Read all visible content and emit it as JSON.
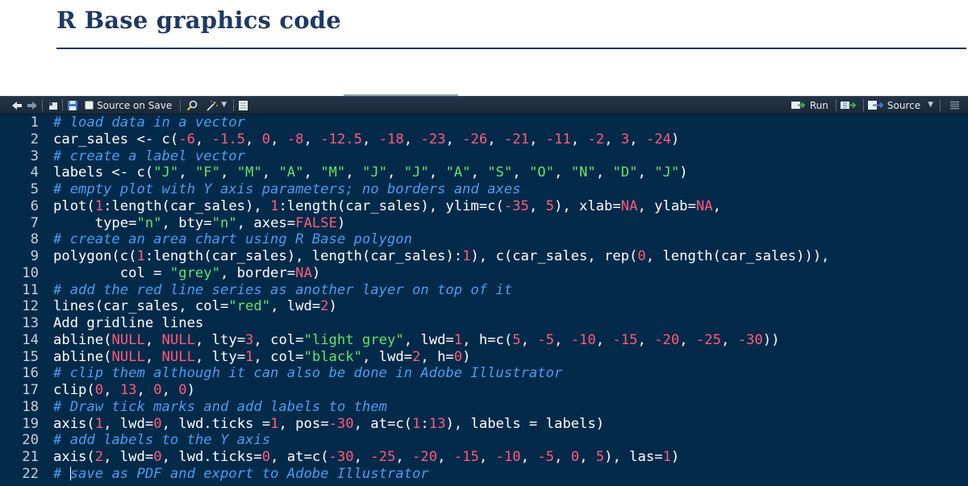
{
  "title": "R Base graphics code",
  "toolbar": {
    "source_on_save_label": "Source on Save",
    "run_label": "Run",
    "source_label": "Source"
  },
  "code_lines": [
    {
      "n": "1",
      "tokens": [
        {
          "t": "# load data in a vector",
          "c": "comment"
        }
      ]
    },
    {
      "n": "2",
      "tokens": [
        {
          "t": "car_sales <- c(",
          "c": "plain"
        },
        {
          "t": "-6",
          "c": "num"
        },
        {
          "t": ", ",
          "c": "plain"
        },
        {
          "t": "-1.5",
          "c": "num"
        },
        {
          "t": ", ",
          "c": "plain"
        },
        {
          "t": "0",
          "c": "num"
        },
        {
          "t": ", ",
          "c": "plain"
        },
        {
          "t": "-8",
          "c": "num"
        },
        {
          "t": ", ",
          "c": "plain"
        },
        {
          "t": "-12.5",
          "c": "num"
        },
        {
          "t": ", ",
          "c": "plain"
        },
        {
          "t": "-18",
          "c": "num"
        },
        {
          "t": ", ",
          "c": "plain"
        },
        {
          "t": "-23",
          "c": "num"
        },
        {
          "t": ", ",
          "c": "plain"
        },
        {
          "t": "-26",
          "c": "num"
        },
        {
          "t": ", ",
          "c": "plain"
        },
        {
          "t": "-21",
          "c": "num"
        },
        {
          "t": ", ",
          "c": "plain"
        },
        {
          "t": "-11",
          "c": "num"
        },
        {
          "t": ", ",
          "c": "plain"
        },
        {
          "t": "-2",
          "c": "num"
        },
        {
          "t": ", ",
          "c": "plain"
        },
        {
          "t": "3",
          "c": "num"
        },
        {
          "t": ", ",
          "c": "plain"
        },
        {
          "t": "-24",
          "c": "num"
        },
        {
          "t": ")",
          "c": "plain"
        }
      ]
    },
    {
      "n": "3",
      "tokens": [
        {
          "t": "# create a label vector",
          "c": "comment"
        }
      ]
    },
    {
      "n": "4",
      "tokens": [
        {
          "t": "labels <- c(",
          "c": "plain"
        },
        {
          "t": "\"J\"",
          "c": "str"
        },
        {
          "t": ", ",
          "c": "plain"
        },
        {
          "t": "\"F\"",
          "c": "str"
        },
        {
          "t": ", ",
          "c": "plain"
        },
        {
          "t": "\"M\"",
          "c": "str"
        },
        {
          "t": ", ",
          "c": "plain"
        },
        {
          "t": "\"A\"",
          "c": "str"
        },
        {
          "t": ", ",
          "c": "plain"
        },
        {
          "t": "\"M\"",
          "c": "str"
        },
        {
          "t": ", ",
          "c": "plain"
        },
        {
          "t": "\"J\"",
          "c": "str"
        },
        {
          "t": ", ",
          "c": "plain"
        },
        {
          "t": "\"J\"",
          "c": "str"
        },
        {
          "t": ", ",
          "c": "plain"
        },
        {
          "t": "\"A\"",
          "c": "str"
        },
        {
          "t": ", ",
          "c": "plain"
        },
        {
          "t": "\"S\"",
          "c": "str"
        },
        {
          "t": ", ",
          "c": "plain"
        },
        {
          "t": "\"O\"",
          "c": "str"
        },
        {
          "t": ", ",
          "c": "plain"
        },
        {
          "t": "\"N\"",
          "c": "str"
        },
        {
          "t": ", ",
          "c": "plain"
        },
        {
          "t": "\"D\"",
          "c": "str"
        },
        {
          "t": ", ",
          "c": "plain"
        },
        {
          "t": "\"J\"",
          "c": "str"
        },
        {
          "t": ")",
          "c": "plain"
        }
      ]
    },
    {
      "n": "5",
      "tokens": [
        {
          "t": "# empty plot with Y axis parameters; no borders and axes",
          "c": "comment"
        }
      ]
    },
    {
      "n": "6",
      "tokens": [
        {
          "t": "plot(",
          "c": "plain"
        },
        {
          "t": "1",
          "c": "num"
        },
        {
          "t": ":length(car_sales), ",
          "c": "plain"
        },
        {
          "t": "1",
          "c": "num"
        },
        {
          "t": ":length(car_sales), ylim=c(",
          "c": "plain"
        },
        {
          "t": "-35",
          "c": "num"
        },
        {
          "t": ", ",
          "c": "plain"
        },
        {
          "t": "5",
          "c": "num"
        },
        {
          "t": "), xlab=",
          "c": "plain"
        },
        {
          "t": "NA",
          "c": "num"
        },
        {
          "t": ", ylab=",
          "c": "plain"
        },
        {
          "t": "NA",
          "c": "num"
        },
        {
          "t": ",",
          "c": "plain"
        }
      ]
    },
    {
      "n": "7",
      "tokens": [
        {
          "t": "     type=",
          "c": "plain"
        },
        {
          "t": "\"n\"",
          "c": "str"
        },
        {
          "t": ", bty=",
          "c": "plain"
        },
        {
          "t": "\"n\"",
          "c": "str"
        },
        {
          "t": ", axes=",
          "c": "plain"
        },
        {
          "t": "FALSE",
          "c": "num"
        },
        {
          "t": ")",
          "c": "plain"
        }
      ]
    },
    {
      "n": "8",
      "tokens": [
        {
          "t": "# create an area chart using R Base polygon",
          "c": "comment"
        }
      ]
    },
    {
      "n": "9",
      "tokens": [
        {
          "t": "polygon(c(",
          "c": "plain"
        },
        {
          "t": "1",
          "c": "num"
        },
        {
          "t": ":length(car_sales), length(car_sales):",
          "c": "plain"
        },
        {
          "t": "1",
          "c": "num"
        },
        {
          "t": "), c(car_sales, rep(",
          "c": "plain"
        },
        {
          "t": "0",
          "c": "num"
        },
        {
          "t": ", length(car_sales))),",
          "c": "plain"
        }
      ]
    },
    {
      "n": "10",
      "tokens": [
        {
          "t": "        col = ",
          "c": "plain"
        },
        {
          "t": "\"grey\"",
          "c": "str"
        },
        {
          "t": ", border=",
          "c": "plain"
        },
        {
          "t": "NA",
          "c": "num"
        },
        {
          "t": ")",
          "c": "plain"
        }
      ]
    },
    {
      "n": "11",
      "tokens": [
        {
          "t": "# add the red line series as another layer on top of it",
          "c": "comment"
        }
      ]
    },
    {
      "n": "12",
      "tokens": [
        {
          "t": "lines(car_sales, col=",
          "c": "plain"
        },
        {
          "t": "\"red\"",
          "c": "str"
        },
        {
          "t": ", lwd=",
          "c": "plain"
        },
        {
          "t": "2",
          "c": "num"
        },
        {
          "t": ")",
          "c": "plain"
        }
      ]
    },
    {
      "n": "13",
      "tokens": [
        {
          "t": "Add gridline lines",
          "c": "plain"
        }
      ]
    },
    {
      "n": "14",
      "tokens": [
        {
          "t": "abline(",
          "c": "plain"
        },
        {
          "t": "NULL",
          "c": "num"
        },
        {
          "t": ", ",
          "c": "plain"
        },
        {
          "t": "NULL",
          "c": "num"
        },
        {
          "t": ", lty=",
          "c": "plain"
        },
        {
          "t": "3",
          "c": "num"
        },
        {
          "t": ", col=",
          "c": "plain"
        },
        {
          "t": "\"light grey\"",
          "c": "str"
        },
        {
          "t": ", lwd=",
          "c": "plain"
        },
        {
          "t": "1",
          "c": "num"
        },
        {
          "t": ", h=c(",
          "c": "plain"
        },
        {
          "t": "5",
          "c": "num"
        },
        {
          "t": ", ",
          "c": "plain"
        },
        {
          "t": "-5",
          "c": "num"
        },
        {
          "t": ", ",
          "c": "plain"
        },
        {
          "t": "-10",
          "c": "num"
        },
        {
          "t": ", ",
          "c": "plain"
        },
        {
          "t": "-15",
          "c": "num"
        },
        {
          "t": ", ",
          "c": "plain"
        },
        {
          "t": "-20",
          "c": "num"
        },
        {
          "t": ", ",
          "c": "plain"
        },
        {
          "t": "-25",
          "c": "num"
        },
        {
          "t": ", ",
          "c": "plain"
        },
        {
          "t": "-30",
          "c": "num"
        },
        {
          "t": "))",
          "c": "plain"
        }
      ]
    },
    {
      "n": "15",
      "tokens": [
        {
          "t": "abline(",
          "c": "plain"
        },
        {
          "t": "NULL",
          "c": "num"
        },
        {
          "t": ", ",
          "c": "plain"
        },
        {
          "t": "NULL",
          "c": "num"
        },
        {
          "t": ", lty=",
          "c": "plain"
        },
        {
          "t": "1",
          "c": "num"
        },
        {
          "t": ", col=",
          "c": "plain"
        },
        {
          "t": "\"black\"",
          "c": "str"
        },
        {
          "t": ", lwd=",
          "c": "plain"
        },
        {
          "t": "2",
          "c": "num"
        },
        {
          "t": ", h=",
          "c": "plain"
        },
        {
          "t": "0",
          "c": "num"
        },
        {
          "t": ")",
          "c": "plain"
        }
      ]
    },
    {
      "n": "16",
      "tokens": [
        {
          "t": "# clip them although it can also be done in Adobe Illustrator",
          "c": "comment"
        }
      ]
    },
    {
      "n": "17",
      "tokens": [
        {
          "t": "clip(",
          "c": "plain"
        },
        {
          "t": "0",
          "c": "num"
        },
        {
          "t": ", ",
          "c": "plain"
        },
        {
          "t": "13",
          "c": "num"
        },
        {
          "t": ", ",
          "c": "plain"
        },
        {
          "t": "0",
          "c": "num"
        },
        {
          "t": ", ",
          "c": "plain"
        },
        {
          "t": "0",
          "c": "num"
        },
        {
          "t": ")",
          "c": "plain"
        }
      ]
    },
    {
      "n": "18",
      "tokens": [
        {
          "t": "# Draw tick marks and add labels to them",
          "c": "comment"
        }
      ]
    },
    {
      "n": "19",
      "tokens": [
        {
          "t": "axis(",
          "c": "plain"
        },
        {
          "t": "1",
          "c": "num"
        },
        {
          "t": ", lwd=",
          "c": "plain"
        },
        {
          "t": "0",
          "c": "num"
        },
        {
          "t": ", lwd.ticks =",
          "c": "plain"
        },
        {
          "t": "1",
          "c": "num"
        },
        {
          "t": ", pos=",
          "c": "plain"
        },
        {
          "t": "-30",
          "c": "num"
        },
        {
          "t": ", at=c(",
          "c": "plain"
        },
        {
          "t": "1",
          "c": "num"
        },
        {
          "t": ":",
          "c": "plain"
        },
        {
          "t": "13",
          "c": "num"
        },
        {
          "t": "), labels = labels)",
          "c": "plain"
        }
      ]
    },
    {
      "n": "20",
      "tokens": [
        {
          "t": "# add labels to the Y axis",
          "c": "comment"
        }
      ]
    },
    {
      "n": "21",
      "tokens": [
        {
          "t": "axis(",
          "c": "plain"
        },
        {
          "t": "2",
          "c": "num"
        },
        {
          "t": ", lwd=",
          "c": "plain"
        },
        {
          "t": "0",
          "c": "num"
        },
        {
          "t": ", lwd.ticks=",
          "c": "plain"
        },
        {
          "t": "0",
          "c": "num"
        },
        {
          "t": ", at=c(",
          "c": "plain"
        },
        {
          "t": "-30",
          "c": "num"
        },
        {
          "t": ", ",
          "c": "plain"
        },
        {
          "t": "-25",
          "c": "num"
        },
        {
          "t": ", ",
          "c": "plain"
        },
        {
          "t": "-20",
          "c": "num"
        },
        {
          "t": ", ",
          "c": "plain"
        },
        {
          "t": "-15",
          "c": "num"
        },
        {
          "t": ", ",
          "c": "plain"
        },
        {
          "t": "-10",
          "c": "num"
        },
        {
          "t": ", ",
          "c": "plain"
        },
        {
          "t": "-5",
          "c": "num"
        },
        {
          "t": ", ",
          "c": "plain"
        },
        {
          "t": "0",
          "c": "num"
        },
        {
          "t": ", ",
          "c": "plain"
        },
        {
          "t": "5",
          "c": "num"
        },
        {
          "t": "), las=",
          "c": "plain"
        },
        {
          "t": "1",
          "c": "num"
        },
        {
          "t": ")",
          "c": "plain"
        }
      ]
    },
    {
      "n": "22",
      "cursor_after": 0,
      "tokens": [
        {
          "t": "# save as PDF and export to Adobe Illustrator",
          "c": "comment"
        }
      ]
    }
  ],
  "colors": {
    "editor_bg": "#042a4a",
    "comment": "#4c9cf0",
    "number": "#ff5a7a",
    "string": "#64e36a",
    "title": "#1f3864"
  },
  "icons": [
    "arrow-left-icon",
    "arrow-right-icon",
    "show-in-window-icon",
    "save-icon",
    "search-icon",
    "magic-wand-icon",
    "compile-report-icon",
    "run-icon",
    "rerun-icon",
    "source-icon",
    "outline-icon"
  ]
}
